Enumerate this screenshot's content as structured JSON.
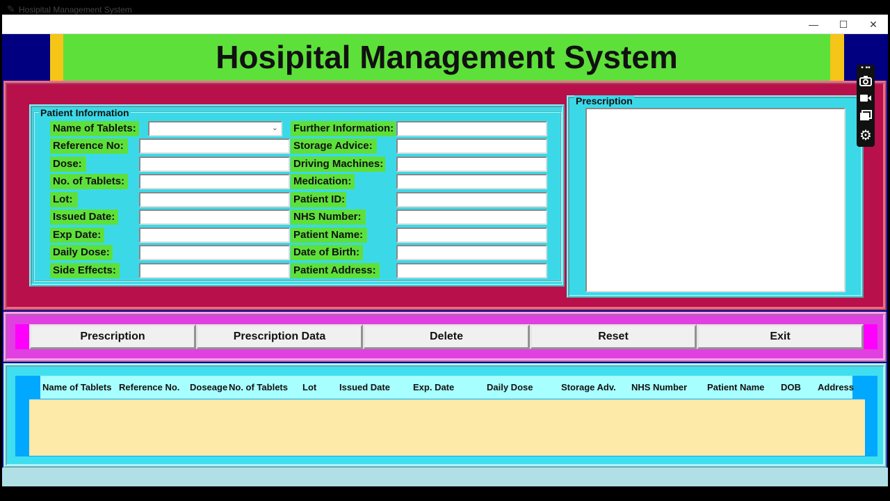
{
  "window": {
    "title": "Hosipital Management System",
    "icon": "feather-icon",
    "controls": {
      "minimize": "—",
      "maximize": "☐",
      "close": "✕"
    }
  },
  "header": {
    "title": "Hosipital Management System"
  },
  "patient_info": {
    "legend": "Patient Information",
    "left_fields": [
      {
        "label": "Name of Tablets:",
        "value": ""
      },
      {
        "label": "Reference No:",
        "value": ""
      },
      {
        "label": "Dose:",
        "value": ""
      },
      {
        "label": "No. of Tablets:",
        "value": ""
      },
      {
        "label": "Lot:",
        "value": ""
      },
      {
        "label": "Issued Date:",
        "value": ""
      },
      {
        "label": "Exp Date:",
        "value": ""
      },
      {
        "label": "Daily Dose:",
        "value": ""
      },
      {
        "label": "Side Effects:",
        "value": ""
      }
    ],
    "right_fields": [
      {
        "label": "Further Information:",
        "value": ""
      },
      {
        "label": "Storage Advice:",
        "value": ""
      },
      {
        "label": "Driving Machines:",
        "value": ""
      },
      {
        "label": "Medication:",
        "value": ""
      },
      {
        "label": "Patient ID:",
        "value": ""
      },
      {
        "label": "NHS Number:",
        "value": ""
      },
      {
        "label": "Patient Name:",
        "value": ""
      },
      {
        "label": "Date of Birth:",
        "value": ""
      },
      {
        "label": "Patient Address:",
        "value": ""
      }
    ]
  },
  "prescription": {
    "legend": "Prescription",
    "text": ""
  },
  "buttons": [
    "Prescription",
    "Prescription Data",
    "Delete",
    "Reset",
    "Exit"
  ],
  "table": {
    "columns": [
      "Name of Tablets",
      "Reference No.",
      "Doseage",
      "No. of Tablets",
      "Lot",
      "Issued Date",
      "Exp. Date",
      "Daily Dose",
      "Storage Adv.",
      "NHS Number",
      "Patient Name",
      "DOB",
      "Address"
    ],
    "rows": []
  },
  "side_toolbar": {
    "icons": [
      "more-icon",
      "camera-icon",
      "video-icon",
      "copy-icon",
      "gear-icon"
    ]
  },
  "colors": {
    "header_green": "#5ee03b",
    "header_gold": "#f5c518",
    "panel_crimson": "#b8104b",
    "panel_cyan": "#3bd9e8",
    "button_magenta": "#ff00ff",
    "table_body": "#fde9a8"
  }
}
